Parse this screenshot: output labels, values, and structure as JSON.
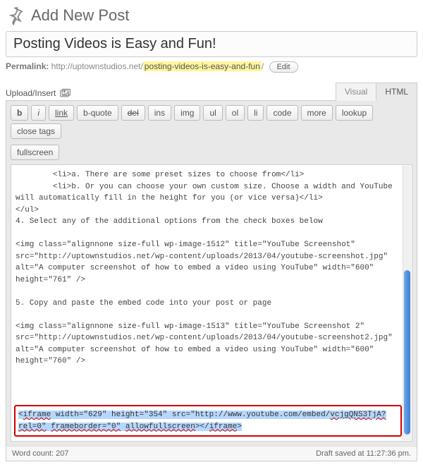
{
  "header": {
    "title": "Add New Post"
  },
  "title_input": {
    "value": "Posting Videos is Easy and Fun!"
  },
  "permalink": {
    "label": "Permalink:",
    "base": "http://uptownstudios.net/",
    "slug": "posting-videos-is-easy-and-fun",
    "trail": "/",
    "edit_label": "Edit"
  },
  "upload_insert": {
    "label": "Upload/Insert"
  },
  "tabs": {
    "visual": "Visual",
    "html": "HTML",
    "active": "html"
  },
  "buttons": {
    "row1": [
      "b",
      "i",
      "link",
      "b-quote",
      "del",
      "ins",
      "img",
      "ul",
      "ol",
      "li",
      "code",
      "more",
      "lookup",
      "close tags"
    ],
    "row2": [
      "fullscreen"
    ]
  },
  "content": {
    "body": "        <li>a. There are some preset sizes to choose from</li>\n        <li>b. Or you can choose your own custom size. Choose a width and YouTube will automatically fill in the height for you (or vice versa)</li>\n</ul>\n4. Select any of the additional options from the check boxes below\n\n<img class=\"alignnone size-full wp-image-1512\" title=\"YouTube Screenshot\" src=\"http://uptownstudios.net/wp-content/uploads/2013/04/youtube-screenshot.jpg\" alt=\"A computer screenshot of how to embed a video using YouTube\" width=\"600\" height=\"761\" />\n\n5. Copy and paste the embed code into your post or page\n\n<img class=\"alignnone size-full wp-image-1513\" title=\"YouTube Screenshot 2\" src=\"http://uptownstudios.net/wp-content/uploads/2013/04/youtube-screenshot2.jpg\" alt=\"A computer screenshot of how to embed a video using YouTube\" width=\"600\" height=\"760\" />\n"
  },
  "highlight": {
    "pre1": "<",
    "tag_open": "iframe",
    "mid1": " width=\"629\" height=\"354\" src=\"http://www.youtube.com/embed/",
    "vid": "vcjgQNS3TjA?",
    "line2a": "rel=0\"",
    "gap1": " ",
    "fb": "frameborder=\"0\"",
    "gap2": " ",
    "afs": "allowfullscreen",
    "close1": "></",
    "tag_close": "iframe",
    "close2": ">"
  },
  "status": {
    "wordcount_label": "Word count:",
    "wordcount_value": "207",
    "draft_saved": "Draft saved at 11:27:36 pm."
  }
}
